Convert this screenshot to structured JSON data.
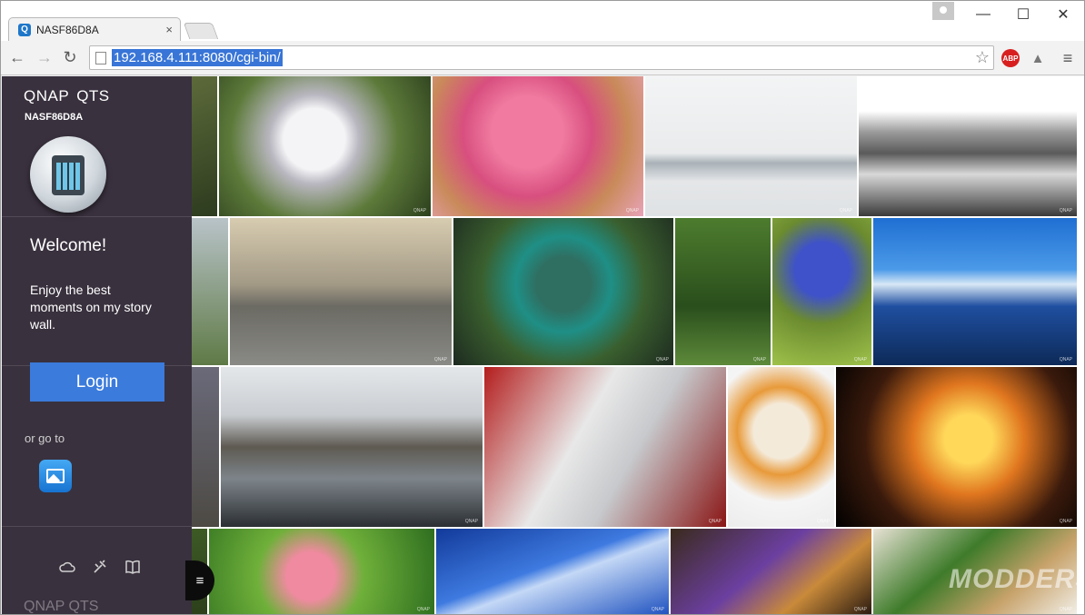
{
  "browser": {
    "tab_title": "NASF86D8A",
    "tab_close": "×",
    "url": "192.168.4.111:8080/cgi-bin/",
    "back": "←",
    "forward": "→",
    "reload": "↻",
    "star": "☆",
    "abp_label": "ABP",
    "drive_glyph": "▲",
    "menu_glyph": "≡",
    "minimize": "—",
    "maximize": "☐",
    "close": "✕"
  },
  "panel": {
    "brand": "QNAP",
    "brand_suffix": "QTS",
    "device_name": "NASF86D8A",
    "welcome_title": "Welcome!",
    "welcome_text": "Enjoy the best moments on my story wall.",
    "login_label": "Login",
    "goto_label": "or go to",
    "ghost_brand": "QNAP",
    "ghost_suffix": "QTS",
    "menu_glyph": "≡"
  },
  "watermark": "QNAP",
  "site_mark": "MODDERS",
  "colors": {
    "login_blue": "#3b7bdc",
    "panel_bg": "#1e1423",
    "url_highlight": "#3875d7"
  },
  "photos": [
    {
      "name": "white-cyclamen"
    },
    {
      "name": "pink-cherry-blossom"
    },
    {
      "name": "foggy-harbor-boats"
    },
    {
      "name": "bw-seascape"
    },
    {
      "name": "street-crossroads"
    },
    {
      "name": "heart-stone-weir"
    },
    {
      "name": "green-stream"
    },
    {
      "name": "blue-flower"
    },
    {
      "name": "stilt-houses-sky"
    },
    {
      "name": "canal-warehouses"
    },
    {
      "name": "race-car-display"
    },
    {
      "name": "ice-cream-cone"
    },
    {
      "name": "carousel-night"
    },
    {
      "name": "pink-lotus"
    },
    {
      "name": "blue-sky-clouds"
    },
    {
      "name": "grilled-eggplant"
    },
    {
      "name": "herb-dish"
    }
  ]
}
